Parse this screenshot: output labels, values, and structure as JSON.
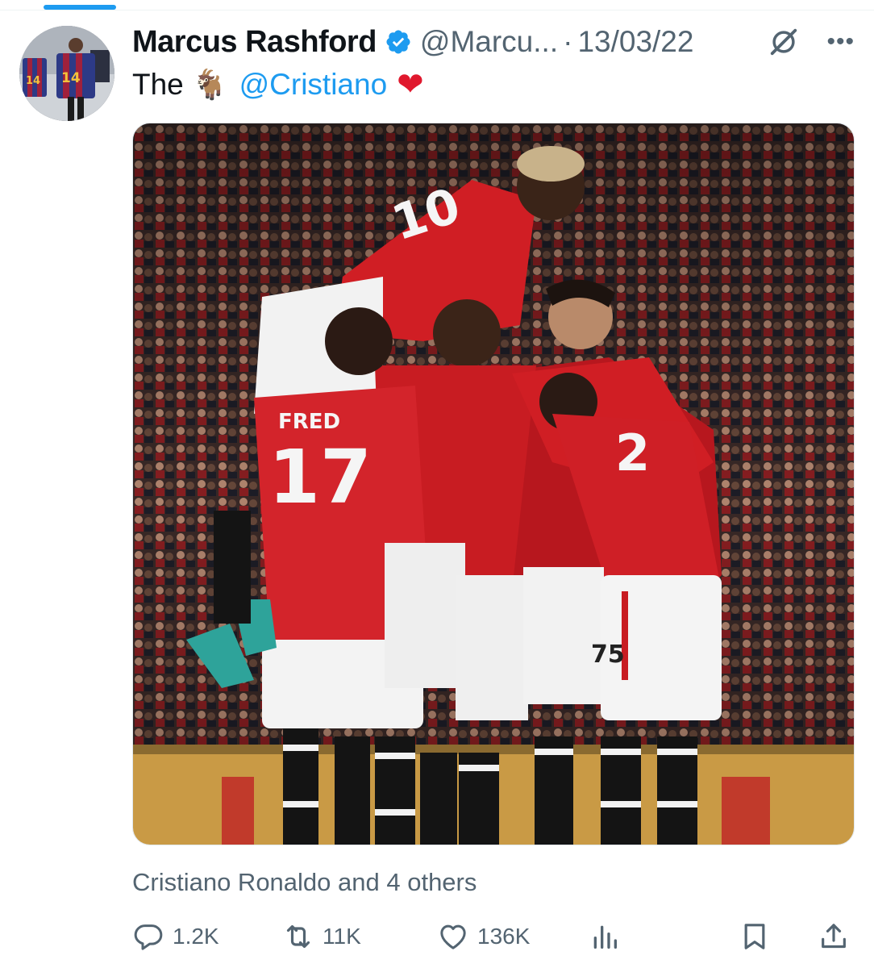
{
  "author": {
    "name": "Marcus Rashford",
    "handle": "@Marcu...",
    "separator": "·",
    "date": "13/03/22"
  },
  "tweet": {
    "text_prefix": "The",
    "goat_emoji": "🐐",
    "mention": "@Cristiano",
    "heart_emoji": "❤"
  },
  "media": {
    "shirt_numbers": [
      "14",
      "14"
    ],
    "player_name": "FRED",
    "player_number": "17",
    "number_10": "10",
    "number_75": "75",
    "number_partial": "2"
  },
  "tagged_people": "Cristiano Ronaldo and 4 others",
  "actions": {
    "reply_count": "1.2K",
    "retweet_count": "11K",
    "like_count": "136K"
  },
  "icons": [
    "verified-badge-icon",
    "grok-icon",
    "more-icon",
    "reply-icon",
    "retweet-icon",
    "like-icon",
    "views-icon",
    "bookmark-icon",
    "share-icon"
  ],
  "colors": {
    "accent": "#1d9bf0",
    "text": "#0f1419",
    "muted": "#536471",
    "heart": "#e0182d",
    "kit_red": "#d01e24"
  }
}
